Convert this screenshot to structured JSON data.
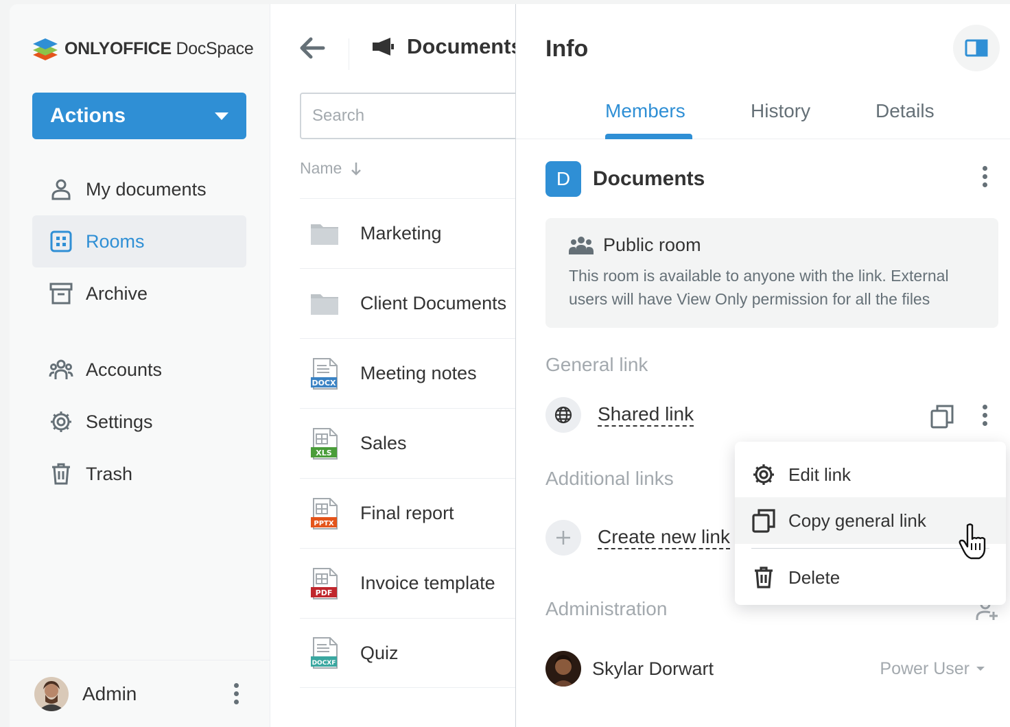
{
  "app": {
    "logo_brand": "ONLYOFFICE",
    "logo_product": "DocSpace"
  },
  "sidebar": {
    "actions_label": "Actions",
    "items": [
      {
        "label": "My documents",
        "icon": "person-icon"
      },
      {
        "label": "Rooms",
        "icon": "rooms-icon",
        "active": true
      },
      {
        "label": "Archive",
        "icon": "archive-icon"
      },
      {
        "label": "Accounts",
        "icon": "accounts-icon"
      },
      {
        "label": "Settings",
        "icon": "gear-icon"
      },
      {
        "label": "Trash",
        "icon": "trash-icon"
      }
    ],
    "user": {
      "name": "Admin"
    }
  },
  "file_list": {
    "room_title": "Documents",
    "search_placeholder": "Search",
    "sort_label": "Name",
    "files": [
      {
        "name": "Marketing",
        "type": "folder"
      },
      {
        "name": "Client Documents",
        "type": "folder"
      },
      {
        "name": "Meeting notes",
        "type": "DOCX",
        "color": "#3b83c4"
      },
      {
        "name": "Sales",
        "type": "XLS",
        "color": "#4a9d3a"
      },
      {
        "name": "Final report",
        "type": "PPTX",
        "color": "#e4541b"
      },
      {
        "name": "Invoice template",
        "type": "PDF",
        "color": "#c0272d"
      },
      {
        "name": "Quiz",
        "type": "DOCXF",
        "color": "#3aa7a0"
      }
    ]
  },
  "info_panel": {
    "title": "Info",
    "tabs": [
      {
        "label": "Members",
        "active": true
      },
      {
        "label": "History"
      },
      {
        "label": "Details"
      }
    ],
    "room_badge_letter": "D",
    "room_name": "Documents",
    "public_room": {
      "title": "Public room",
      "description": "This room is available to anyone with the link. External users will have View Only permission for all the files"
    },
    "general_link_label": "General link",
    "shared_link_label": "Shared link",
    "additional_links_label": "Additional links",
    "create_link_label": "Create new link",
    "administration_label": "Administration",
    "member": {
      "name": "Skylar Dorwart",
      "role": "Power User"
    }
  },
  "context_menu": {
    "items": [
      {
        "label": "Edit link",
        "icon": "gear-icon"
      },
      {
        "label": "Copy general link",
        "icon": "copy-icon",
        "hovered": true
      },
      {
        "label": "Delete",
        "icon": "trash-icon"
      }
    ]
  },
  "colors": {
    "accent": "#2f8fd5",
    "text": "#333333",
    "muted": "#a3a9ae",
    "active_bg": "#eceef1"
  }
}
